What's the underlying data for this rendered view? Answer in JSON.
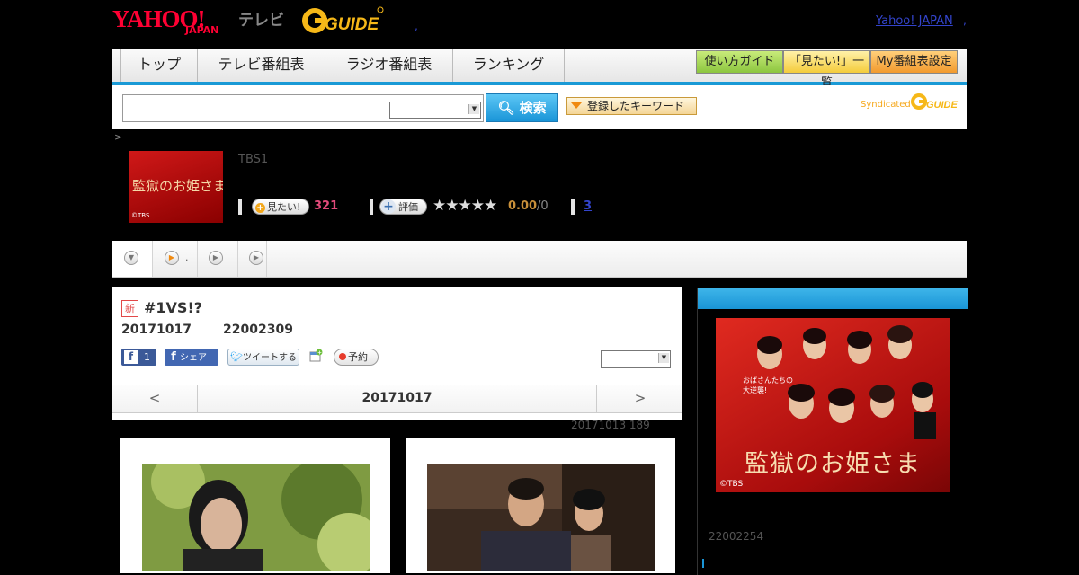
{
  "header": {
    "logo_yahoo": "YAHOO!",
    "logo_japan": "JAPAN",
    "logo_tv": "テレビ",
    "logo_gguide": "G GUIDE",
    "yj_link": "Yahoo! JAPAN",
    "dot_a": ",",
    "dot_b": ","
  },
  "nav": {
    "items": [
      "トップ",
      "テレビ番組表",
      "ラジオ番組表",
      "ランキング"
    ],
    "buttons": [
      "使い方ガイド",
      "「見たい!」一覧",
      "My番組表設定"
    ]
  },
  "search": {
    "input_value": "",
    "select_value": "",
    "button_label": "検索",
    "keyword_label": "登録したキーワード",
    "syndicated": "Syndicated"
  },
  "program": {
    "crumb": ">",
    "thumb_title": "監獄のお姫さま",
    "thumb_copyright": "©TBS",
    "station": "TBS1",
    "want_label": "見たい!",
    "want_count": "321",
    "rate_label": "評価",
    "stars": "★★★★★",
    "score": "0.00",
    "score_sub": "/0",
    "review_count": "3"
  },
  "tabs": {
    "tab2_label": "."
  },
  "episode": {
    "new_badge": "新",
    "title": "#1VS!?",
    "date": "20171017",
    "time": "22002309",
    "fb_like_count": "1",
    "fb_share_label": "シェア",
    "tweet_label": "ツイートする",
    "reserve_label": "予約",
    "nav_prev": "<",
    "nav_date": "20171017",
    "nav_next": ">",
    "updated": "20171013  189"
  },
  "sidebar": {
    "poster_title": "監獄のお姫さま",
    "poster_slogan": "おばさんたちの\n大逆襲!",
    "poster_copyright": "©TBS",
    "time": "22002254"
  },
  "colors": {
    "accent_blue": "#1a9ad6",
    "yahoo_red": "#ff0033",
    "want_pink": "#e24a7a",
    "score_gold": "#c9903a"
  }
}
